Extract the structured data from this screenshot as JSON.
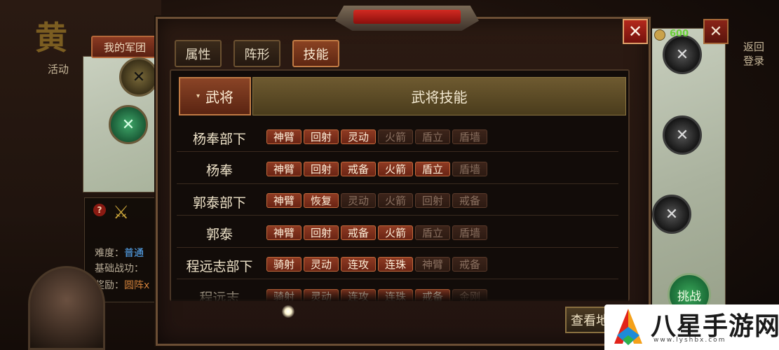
{
  "background": {
    "big_char": "黄",
    "activity_label": "活动",
    "my_army_button": "我的军团",
    "info": {
      "difficulty_label": "难度：",
      "difficulty_value": "普通",
      "base_power_label": "基础战功：",
      "reward_label": "奖励：",
      "reward_value": "圆阵x"
    },
    "coin_value": "600",
    "right_labels": [
      "返回",
      "登录"
    ],
    "challenge_button": "挑战"
  },
  "dialog": {
    "tabs": [
      {
        "label": "属性",
        "active": false
      },
      {
        "label": "阵形",
        "active": false
      },
      {
        "label": "技能",
        "active": true
      }
    ],
    "header": {
      "general_label": "武将",
      "skills_label": "武将技能"
    },
    "rows": [
      {
        "name": "杨奉部下",
        "skills": [
          {
            "label": "神臂",
            "active": true
          },
          {
            "label": "回射",
            "active": true
          },
          {
            "label": "灵动",
            "active": true
          },
          {
            "label": "火箭",
            "active": false
          },
          {
            "label": "盾立",
            "active": false
          },
          {
            "label": "盾墙",
            "active": false
          }
        ]
      },
      {
        "name": "杨奉",
        "skills": [
          {
            "label": "神臂",
            "active": true
          },
          {
            "label": "回射",
            "active": true
          },
          {
            "label": "戒备",
            "active": true
          },
          {
            "label": "火箭",
            "active": true
          },
          {
            "label": "盾立",
            "active": true
          },
          {
            "label": "盾墙",
            "active": false
          }
        ]
      },
      {
        "name": "郭泰部下",
        "skills": [
          {
            "label": "神臂",
            "active": true
          },
          {
            "label": "恢复",
            "active": true
          },
          {
            "label": "灵动",
            "active": false
          },
          {
            "label": "火箭",
            "active": false
          },
          {
            "label": "回射",
            "active": false
          },
          {
            "label": "戒备",
            "active": false
          }
        ]
      },
      {
        "name": "郭泰",
        "skills": [
          {
            "label": "神臂",
            "active": true
          },
          {
            "label": "回射",
            "active": true
          },
          {
            "label": "戒备",
            "active": true
          },
          {
            "label": "火箭",
            "active": true
          },
          {
            "label": "盾立",
            "active": false
          },
          {
            "label": "盾墙",
            "active": false
          }
        ]
      },
      {
        "name": "程远志部下",
        "skills": [
          {
            "label": "骑射",
            "active": true
          },
          {
            "label": "灵动",
            "active": true
          },
          {
            "label": "连攻",
            "active": true
          },
          {
            "label": "连珠",
            "active": true
          },
          {
            "label": "神臂",
            "active": false
          },
          {
            "label": "戒备",
            "active": false
          }
        ]
      },
      {
        "name": "程远志",
        "skills": [
          {
            "label": "骑射",
            "active": true
          },
          {
            "label": "灵动",
            "active": true
          },
          {
            "label": "连攻",
            "active": true
          },
          {
            "label": "连珠",
            "active": true
          },
          {
            "label": "戒备",
            "active": true
          },
          {
            "label": "金刚",
            "active": false
          }
        ]
      }
    ],
    "view_button": "查看地"
  },
  "watermark": {
    "brand": "八星手游网",
    "url": "www.lyshbx.com"
  },
  "colors": {
    "skill_active_bg": "#8e3a22",
    "skill_inactive_bg": "#3c241a",
    "tab_active_bg": "#8a4222",
    "header_skill_bg": "#6e5a30",
    "close_red": "#b3281c"
  }
}
